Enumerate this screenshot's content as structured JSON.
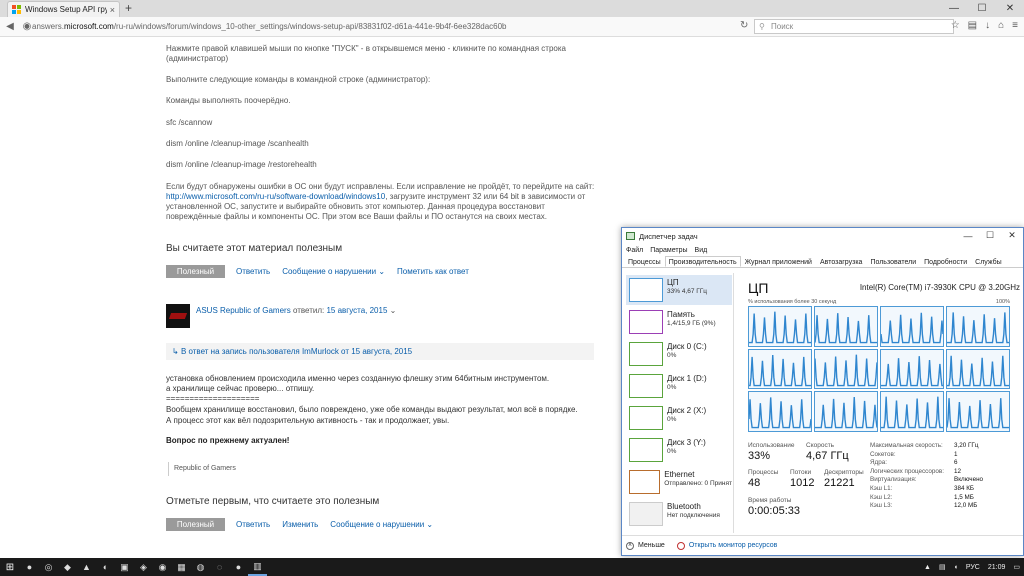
{
  "browser": {
    "tab_title": "Windows Setup API грузи...",
    "tab_close": "×",
    "new_tab": "+",
    "url_prefix": "answers.",
    "url_domain": "microsoft.com",
    "url_path": "/ru-ru/windows/forum/windows_10-other_settings/windows-setup-api/83831f02-d61a-441e-9b4f-6ee328dac60b",
    "search_placeholder": "Поиск",
    "window_controls": [
      "—",
      "☐",
      "✕"
    ]
  },
  "post": {
    "p1": "Нажмите правой клавишей мыши по кнопке \"ПУСК\" - в открывшемся меню - кликните по командная строка (администратор)",
    "p2": "Выполните следующие команды в командной строке (администратор):",
    "p3": "Команды выполнять поочерёдно.",
    "cmd1": "sfc /scannow",
    "cmd2": "dism /online /cleanup-image /scanhealth",
    "cmd3": "dism /online /cleanup-image /restorehealth",
    "p4a": "Если будут обнаружены ошибки в ОС они будут исправлены. Если исправление не пройдёт, то перейдите на сайт:",
    "p4_link": "http://www.microsoft.com/ru-ru/software-download/windows10",
    "p4b": ", загрузите инструмент 32 или 64 bit в зависимости от установленной ОС, запустите и выбирайте обновить этот компьютер. Данная процедура восстановит повреждённые файлы и компоненты ОС. При этом все Ваши файлы и ПО останутся на своих местах.",
    "helpful_question": "Вы считаете этот материал полезным",
    "helpful_btn": "Полезный",
    "reply": "Ответить",
    "report": "Сообщение о нарушении",
    "mark_answer": "Пометить как ответ"
  },
  "reply_post": {
    "author": "ASUS Republic of Gamers",
    "replied": "ответил:",
    "date": "15 августа, 2015",
    "in_reply_to": "В ответ на запись пользователя ImMurlock от 15 августа, 2015",
    "line1": "установка обновлением происходила именно через созданную флешку этим 64битным инструментом.",
    "line2": "а хранилище сейчас проверю... отпишу.",
    "line3": "====================",
    "line4": "Вообщем хранилище восстановил, было повреждено, уже обе команды выдают результат, мол всё в порядке.",
    "line5": "А процесс этот как вёл подозрительную активность - так и продолжает, увы.",
    "bold": "Вопрос по прежнему актуален!",
    "signature": "Republic of Gamers",
    "first_helpful": "Отметьте первым, что считаете это полезным",
    "helpful_btn": "Полезный",
    "reply": "Ответить",
    "edit": "Изменить",
    "report": "Сообщение о нарушении"
  },
  "taskmgr": {
    "title": "Диспетчер задач",
    "menu": [
      "Файл",
      "Параметры",
      "Вид"
    ],
    "tabs": [
      "Процессы",
      "Производительность",
      "Журнал приложений",
      "Автозагрузка",
      "Пользователи",
      "Подробности",
      "Службы"
    ],
    "sidebar": [
      {
        "name": "ЦП",
        "sub": "33% 4,67 ГГц",
        "color": "#4d9ad6"
      },
      {
        "name": "Память",
        "sub": "1,4/15,9 ГБ (9%)",
        "color": "#9b3fb5"
      },
      {
        "name": "Диск 0 (C:)",
        "sub": "0%",
        "color": "#5aa43c"
      },
      {
        "name": "Диск 1 (D:)",
        "sub": "0%",
        "color": "#5aa43c"
      },
      {
        "name": "Диск 2 (X:)",
        "sub": "0%",
        "color": "#5aa43c"
      },
      {
        "name": "Диск 3 (Y:)",
        "sub": "0%",
        "color": "#5aa43c"
      },
      {
        "name": "Ethernet",
        "sub": "Отправлено: 0 Принят",
        "color": "#b86d2d"
      },
      {
        "name": "Bluetooth",
        "sub": "Нет подключения",
        "color": "#aaaaaa"
      }
    ],
    "cpu_heading": "ЦП",
    "cpu_model": "Intel(R) Core(TM) i7-3930K CPU @ 3.20GHz",
    "graph_caption": "% использования более 30 секунд",
    "graph_max": "100%",
    "usage_label": "Использование",
    "usage_value": "33%",
    "speed_label": "Скорость",
    "speed_value": "4,67 ГГц",
    "proc_label": "Процессы",
    "proc_value": "48",
    "threads_label": "Потоки",
    "threads_value": "1012",
    "handles_label": "Дескрипторы",
    "handles_value": "21221",
    "uptime_label": "Время работы",
    "uptime_value": "0:00:05:33",
    "kv": [
      {
        "k": "Максимальная скорость:",
        "v": "3,20 ГГц"
      },
      {
        "k": "Сокетов:",
        "v": "1"
      },
      {
        "k": "Ядра:",
        "v": "6"
      },
      {
        "k": "Логических процессоров:",
        "v": "12"
      },
      {
        "k": "Виртуализация:",
        "v": "Включено"
      },
      {
        "k": "Кэш L1:",
        "v": "384 КБ"
      },
      {
        "k": "Кэш L2:",
        "v": "1,5 МБ"
      },
      {
        "k": "Кэш L3:",
        "v": "12,0 МБ"
      }
    ],
    "less": "Меньше",
    "monitor": "Открыть монитор ресурсов"
  },
  "taskbar": {
    "lang": "РУС",
    "time": "21:09"
  }
}
